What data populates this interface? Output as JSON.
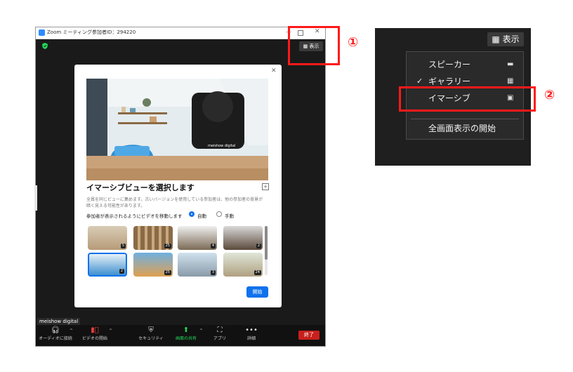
{
  "zoom_window": {
    "title": "Zoom ミーティング参加者ID：294220",
    "view_button": "表示",
    "participant_name": "meishow digital",
    "toolbar": {
      "audio": "オーディオに接続",
      "video": "ビデオの開始",
      "security": "セキュリティ",
      "share": "画面の共有",
      "apps": "アプリ",
      "more": "詳細",
      "end": "終了"
    }
  },
  "dialog": {
    "preview_brand": "meishow digital",
    "title": "イマーシブビューを選択します",
    "description_line1": "全員を同じビューに集めます。古いバージョンを使用している参加者は、他の参加者の背景が",
    "description_line2": "暗く見える可能性があります。",
    "move_label": "参加者が表示されるようにビデオを移動します",
    "radio_auto": "自動",
    "radio_manual": "手動",
    "thumbnails": [
      {
        "badge": "5"
      },
      {
        "badge": "25"
      },
      {
        "badge": "4"
      },
      {
        "badge": "2"
      },
      {
        "badge": "2"
      },
      {
        "badge": "25"
      },
      {
        "badge": "3"
      },
      {
        "badge": "24"
      }
    ],
    "start_button": "開始"
  },
  "annotations": {
    "marker1": "①",
    "marker2": "②"
  },
  "view_menu": {
    "button": "表示",
    "items": [
      {
        "label": "スピーカー",
        "icon": "speaker-view-icon"
      },
      {
        "label": "ギャラリー",
        "icon": "gallery-grid-icon",
        "checked": true
      },
      {
        "label": "イマーシブ",
        "icon": "immersive-icon"
      },
      {
        "label": "全画面表示の開始",
        "icon": ""
      }
    ],
    "checkmark": "✓"
  },
  "colors": {
    "accent_blue": "#0e72ed",
    "highlight_red": "#ff1a1a",
    "end_red": "#c8201c"
  }
}
